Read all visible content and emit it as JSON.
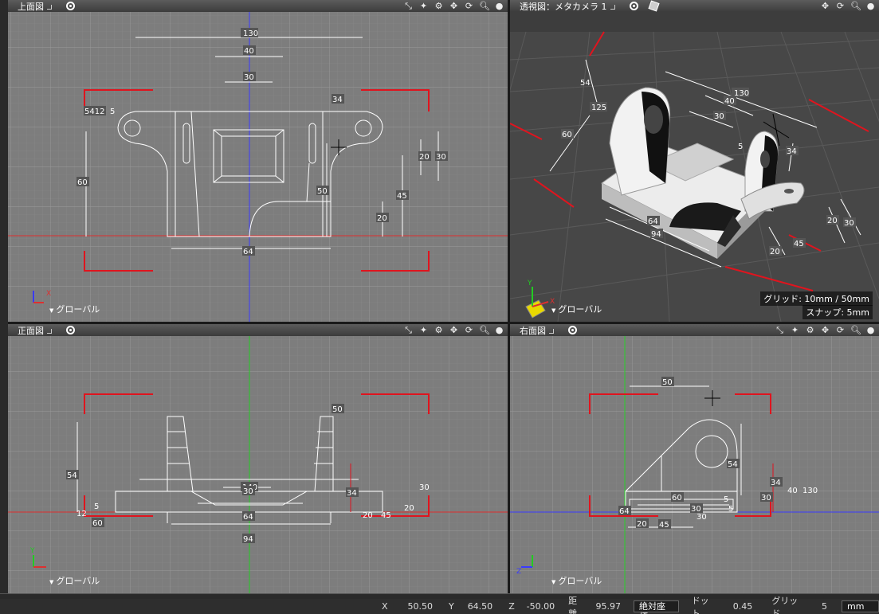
{
  "viewports": {
    "top": {
      "title": "上面図",
      "footer": "グローバル"
    },
    "perspective": {
      "title": "透視図：メタカメラ 1",
      "footer": "グローバル",
      "grid_info": "グリッド: 10mm / 50mm",
      "snap_info": "スナップ: 5mm"
    },
    "front": {
      "title": "正面図",
      "footer": "グローバル"
    },
    "right": {
      "title": "右面図",
      "footer": "グローバル"
    }
  },
  "axis_labels": {
    "x": "X",
    "y": "Y",
    "z": "Z"
  },
  "dims_top": [
    "130",
    "40",
    "30",
    "34",
    "5412",
    "5",
    "60",
    "20",
    "30",
    "50",
    "45",
    "20",
    "64"
  ],
  "dims_persp": [
    "54",
    "130",
    "40",
    "30",
    "60",
    "34",
    "5",
    "125",
    "64",
    "94",
    "20",
    "30",
    "45",
    "20"
  ],
  "dims_front": [
    "50",
    "54",
    "140",
    "30",
    "34",
    "64",
    "94",
    "5",
    "12",
    "60",
    "20",
    "45",
    "30",
    "20"
  ],
  "dims_right": [
    "50",
    "54",
    "34",
    "40",
    "130",
    "30",
    "60",
    "30",
    "5",
    "64",
    "20",
    "45",
    "30",
    "5"
  ],
  "status": {
    "x_label": "X",
    "x_value": "50.50",
    "y_label": "Y",
    "y_value": "64.50",
    "z_label": "Z",
    "z_value": "-50.00",
    "dist_label": "距離",
    "dist_value": "95.97",
    "coord_mode": "絶対座標",
    "dot_label": "ドット",
    "dot_value": "0.45",
    "grid_label": "グリッド",
    "grid_value": "5",
    "unit": "mm"
  },
  "colors": {
    "grid_bg": "#7d7d7d",
    "persp_bg": "#4a4a4a",
    "bracket_red": "#e0141e",
    "axis_blue": "#3a3aff",
    "axis_green": "#22cc22",
    "axis_red": "#dd3030"
  }
}
